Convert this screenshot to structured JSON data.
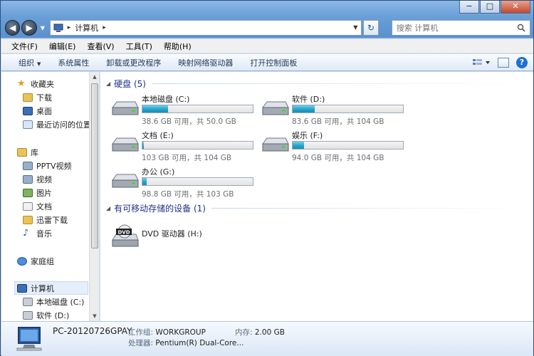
{
  "window": {
    "buttons": {
      "minimize": "−",
      "maximize": "□",
      "close": "✕"
    }
  },
  "address": {
    "back_icon": "back-arrow-icon",
    "forward_icon": "forward-arrow-icon",
    "path_separator": "▸",
    "path": "计算机",
    "refresh_icon": "refresh-icon"
  },
  "search": {
    "placeholder": "搜索 计算机"
  },
  "menu": {
    "items": [
      "文件(F)",
      "编辑(E)",
      "查看(V)",
      "工具(T)",
      "帮助(H)"
    ]
  },
  "commands": {
    "organize": "组织",
    "system_properties": "系统属性",
    "uninstall": "卸载或更改程序",
    "map_drive": "映射网络驱动器",
    "control_panel": "打开控制面板"
  },
  "nav": {
    "favorites": "收藏夹",
    "downloads": "下载",
    "desktop": "桌面",
    "recent": "最近访问的位置",
    "libraries": "库",
    "pptv": "PPTV视频",
    "video": "视频",
    "pictures": "图片",
    "documents": "文档",
    "xunlei": "迅雷下载",
    "music": "音乐",
    "homegroup": "家庭组",
    "computer": "计算机",
    "local_c": "本地磁盘 (C:)",
    "soft_d": "软件 (D:)"
  },
  "groups": {
    "hard_disks": "硬盘 (5)",
    "removable": "有可移动存储的设备 (1)"
  },
  "drives": [
    {
      "name": "本地磁盘 (C:)",
      "info": "38.6 GB 可用，共 50.0 GB",
      "used_fraction": 0.23
    },
    {
      "name": "软件 (D:)",
      "info": "83.6 GB 可用，共 104 GB",
      "used_fraction": 0.2
    },
    {
      "name": "文档 (E:)",
      "info": "103 GB 可用，共 104 GB",
      "used_fraction": 0.01
    },
    {
      "name": "娱乐 (F:)",
      "info": "94.0 GB 可用，共 104 GB",
      "used_fraction": 0.1
    },
    {
      "name": "办公 (G:)",
      "info": "98.8 GB 可用，共 103 GB",
      "used_fraction": 0.04
    }
  ],
  "dvd": {
    "name": "DVD 驱动器 (H:)",
    "badge": "DVD"
  },
  "details": {
    "pc_name": "PC-20120726GPAY",
    "workgroup_label": "工作组:",
    "workgroup": "WORKGROUP",
    "memory_label": "内存:",
    "memory": "2.00 GB",
    "cpu_label": "处理器:",
    "cpu": "Pentium(R) Dual-Core..."
  },
  "colors": {
    "accent": "#1e3287",
    "bar_fill": "#27a3c8",
    "window_frame": "#6a9fd8"
  }
}
